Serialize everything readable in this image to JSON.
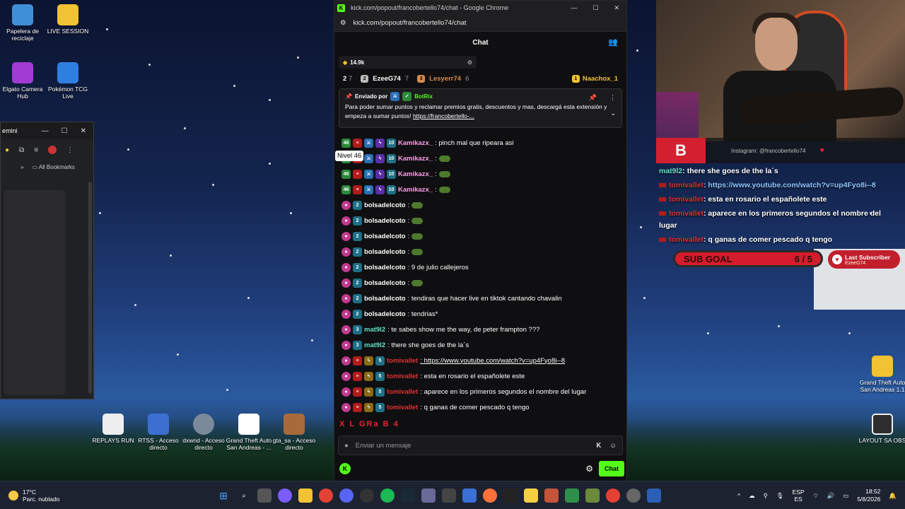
{
  "desktop": {
    "icons_top": [
      {
        "label_l1": "Papelera de",
        "label_l2": "reciclaje",
        "color": "#3f8fd6"
      },
      {
        "label_l1": "LIVE SESSION",
        "label_l2": "",
        "color": "#f1c232"
      },
      {
        "label_l1": "Elgato Camera",
        "label_l2": "Hub",
        "color": "#a13bd4"
      },
      {
        "label_l1": "Pokémon TCG",
        "label_l2": "Live",
        "color": "#2f7fe0"
      }
    ],
    "icons_bottom": [
      {
        "label_l1": "REPLAYS RUN",
        "label_l2": ""
      },
      {
        "label_l1": "RTSS - Acceso",
        "label_l2": "directo"
      },
      {
        "label_l1": "dxwnd - Acceso",
        "label_l2": "directo"
      },
      {
        "label_l1": "Grand Theft Auto",
        "label_l2": "San Andreas - ..."
      },
      {
        "label_l1": "gta_sa - Acceso",
        "label_l2": "directo"
      }
    ],
    "icons_right": [
      {
        "label_l1": "Grand Theft Auto",
        "label_l2": "San Andreas 1.1"
      },
      {
        "label_l1": "LAYOUT SA OBS",
        "label_l2": ""
      }
    ]
  },
  "left_browser": {
    "tab_title": "emini",
    "bookmarks_label": "All Bookmarks"
  },
  "chat_window": {
    "title": "kick.com/popout/francobertello74/chat - Google Chrome",
    "url": "kick.com/popout/francobertello74/chat",
    "header": "Chat",
    "pinned_sub_count": "14.9k",
    "leaderboard": [
      {
        "rank": "2",
        "num": "7",
        "name": "",
        "badge_color": ""
      },
      {
        "rank": "2",
        "num": "7",
        "name": "EzeeG74",
        "badge_color": "#bbbbbb"
      },
      {
        "rank": "3",
        "num": "6",
        "name": "Lesyerr74",
        "badge_color": "#d98a4d"
      },
      {
        "rank": "1",
        "num": "",
        "name": "Naachox_1",
        "badge_color": "#f1c232"
      }
    ],
    "pinned": {
      "sent_by_label": "Enviado por",
      "bot_name": "BotRix",
      "text": "Para poder sumar puntos y reclamar premios gratis, descuentos y mas, descargá esta extensión y empeza a sumar puntos!",
      "link": "https://francobertello-..."
    },
    "tooltip": "Nivel 46",
    "messages": [
      {
        "badges": "46|red|blue|purple|10",
        "user": "Kamikazx_",
        "color": "#ff9ee8",
        "text": ": pinch mal que ripeara asi",
        "emote": false
      },
      {
        "badges": "46|red|blue|purple|10",
        "user": "Kamikazx_",
        "color": "#ff9ee8",
        "text": ":",
        "emote": true
      },
      {
        "badges": "46|red|blue|purple|10",
        "user": "Kamikazx_",
        "color": "#ff9ee8",
        "text": ":",
        "emote": true
      },
      {
        "badges": "46|red|blue|purple|10",
        "user": "Kamikazx_",
        "color": "#ff9ee8",
        "text": ":",
        "emote": true
      },
      {
        "badges": "pink|2",
        "user": "bolsadelcoto",
        "color": "#ffffff",
        "text": ":",
        "emote": true
      },
      {
        "badges": "pink|2",
        "user": "bolsadelcoto",
        "color": "#ffffff",
        "text": ":",
        "emote": true
      },
      {
        "badges": "pink|2",
        "user": "bolsadelcoto",
        "color": "#ffffff",
        "text": ":",
        "emote": true
      },
      {
        "badges": "pink|2",
        "user": "bolsadelcoto",
        "color": "#ffffff",
        "text": ":",
        "emote": true
      },
      {
        "badges": "pink|2",
        "user": "bolsadelcoto",
        "color": "#ffffff",
        "text": ": 9 de julio callejeros",
        "emote": false
      },
      {
        "badges": "pink|2",
        "user": "bolsadelcoto",
        "color": "#ffffff",
        "text": ":",
        "emote": true
      },
      {
        "badges": "pink|2",
        "user": "bolsadelcoto",
        "color": "#ffffff",
        "text": ": tendiras que hacer live en tiktok cantando chavalin",
        "emote": false
      },
      {
        "badges": "pink|2",
        "user": "bolsadelcoto",
        "color": "#ffffff",
        "text": ": tendrias*",
        "emote": false
      },
      {
        "badges": "pink|3",
        "user": "mat9l2",
        "color": "#5fe3c6",
        "text": ": te sabes show me the way, de peter frampton ???",
        "emote": false
      },
      {
        "badges": "pink|3",
        "user": "mat9l2",
        "color": "#5fe3c6",
        "text": ": there she goes de the la´s",
        "emote": false
      },
      {
        "badges": "pink|red|gold|5",
        "user": "tomivallet",
        "color": "#e03131",
        "text": ": https://www.youtube.com/watch?v=up4Fyo8i--8",
        "emote": false
      },
      {
        "badges": "pink|red|gold|5",
        "user": "tomivallet",
        "color": "#e03131",
        "text": ": esta en rosario el españolete este",
        "emote": false
      },
      {
        "badges": "pink|red|gold|5",
        "user": "tomivallet",
        "color": "#e03131",
        "text": ": aparece en los primeros segundos el nombre del lugar",
        "emote": false
      },
      {
        "badges": "pink|red|gold|5",
        "user": "tomivallet",
        "color": "#e03131",
        "text": ": q ganas de comer pescado q tengo",
        "emote": false
      }
    ],
    "emote_bar": "X L GRa B 4",
    "input_placeholder": "Enviar un mensaje",
    "chat_button": "Chat"
  },
  "overlay": {
    "instagram": "Instagram: @francobertello74",
    "chat": [
      {
        "user": "mat9l2",
        "text": ": there she goes de the la´s",
        "style": "green"
      },
      {
        "user": "tomivallet",
        "text": ": https://www.youtube.com/watch?v=up4Fyo8i--8",
        "style": "red-link"
      },
      {
        "user": "tomivallet",
        "text": ": esta en rosario el españolete este",
        "style": "red"
      },
      {
        "user": "tomivallet",
        "text": ": aparece en los primeros segundos el nombre del lugar",
        "style": "red"
      },
      {
        "user": "tomivallet",
        "text": ": q ganas de comer pescado q tengo",
        "style": "red"
      }
    ],
    "sub_goal_label": "SUB GOAL",
    "sub_goal_count": "6 / 5",
    "last_subscriber_label": "Last Subscriber",
    "last_subscriber_name": "EzeeG74"
  },
  "taskbar": {
    "temp": "17°C",
    "weather": "Parc. nublado",
    "lang_l1": "ESP",
    "lang_l2": "ES",
    "time": "18:52",
    "date": "5/8/2026"
  }
}
